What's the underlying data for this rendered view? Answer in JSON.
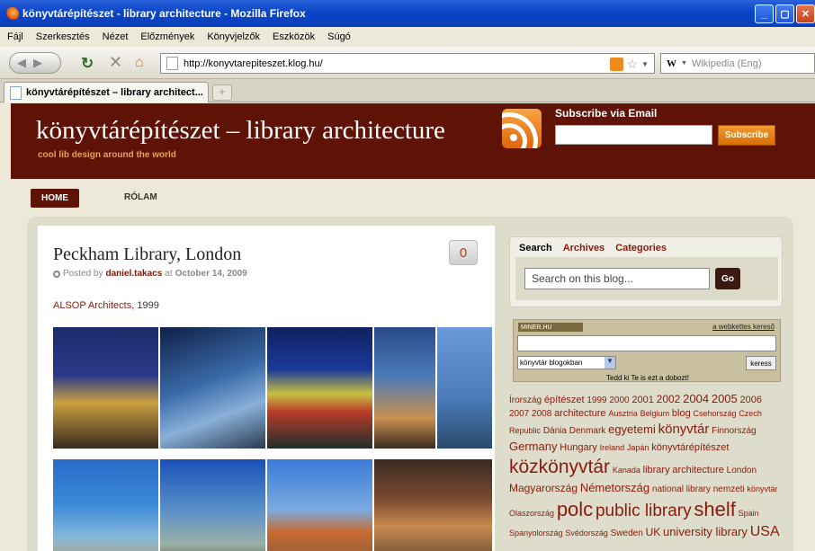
{
  "window": {
    "title": "könyvtárépítészet - library architecture - Mozilla Firefox"
  },
  "menu": [
    "Fájl",
    "Szerkesztés",
    "Nézet",
    "Előzmények",
    "Könyvjelzők",
    "Eszközök",
    "Súgó"
  ],
  "nav": {
    "url": "http://konyvtarepiteszet.klog.hu/",
    "search_engine_letter": "W",
    "search_placeholder": "Wikipedia (Eng)"
  },
  "tab": {
    "label": "könyvtárépítészet – library architect...",
    "new_tab": "+"
  },
  "site": {
    "title": "könyvtárépítészet – library architecture",
    "tagline": "cool lib design around the world",
    "subscribe_label": "Subscribe via Email",
    "subscribe_button": "Subscribe",
    "menu": {
      "home": "HOME",
      "rolam": "RÓLAM"
    }
  },
  "post": {
    "title": "Peckham Library, London",
    "posted_by": "Posted by",
    "author": "daniel.takacs",
    "at": "at",
    "date": "October 14, 2009",
    "comments": "0",
    "text_link": "ALSOP Architects",
    "text_rest": ", 1999"
  },
  "sidebar": {
    "tabs": [
      "Search",
      "Archives",
      "Categories"
    ],
    "search_placeholder": "Search on this blog...",
    "search_button": "Go"
  },
  "miner": {
    "logo": "MINER.HU",
    "link": "a webkettes kereső",
    "select": "könyvtár blogokban",
    "button": "keress",
    "footer": "Tedd ki Te is ezt a dobozt!"
  },
  "tags": [
    {
      "t": "Írország",
      "s": 10
    },
    {
      "t": "építészet",
      "s": 11
    },
    {
      "t": "1999",
      "s": 10
    },
    {
      "t": "2000",
      "s": 10
    },
    {
      "t": "2001",
      "s": 11
    },
    {
      "t": "2002",
      "s": 12
    },
    {
      "t": "2004",
      "s": 13
    },
    {
      "t": "2005",
      "s": 13
    },
    {
      "t": "2006",
      "s": 11
    },
    {
      "t": "2007",
      "s": 10
    },
    {
      "t": "2008",
      "s": 10
    },
    {
      "t": "architecture",
      "s": 11
    },
    {
      "t": "Ausztria",
      "s": 9
    },
    {
      "t": "Belgium",
      "s": 9
    },
    {
      "t": "blog",
      "s": 11
    },
    {
      "t": "Csehország",
      "s": 9
    },
    {
      "t": "Czech Republic",
      "s": 9
    },
    {
      "t": "Dánia",
      "s": 10
    },
    {
      "t": "Denmark",
      "s": 10
    },
    {
      "t": "egyetemi",
      "s": 13
    },
    {
      "t": "könyvtár",
      "s": 15
    },
    {
      "t": "Finnország",
      "s": 10
    },
    {
      "t": "Germany",
      "s": 13
    },
    {
      "t": "Hungary",
      "s": 11
    },
    {
      "t": "Ireland",
      "s": 9
    },
    {
      "t": "Japán",
      "s": 9
    },
    {
      "t": "könyvtárépítészet",
      "s": 11
    },
    {
      "t": "közkönyvtár",
      "s": 21
    },
    {
      "t": "Kanada",
      "s": 9
    },
    {
      "t": "library",
      "s": 11
    },
    {
      "t": "architecture",
      "s": 11
    },
    {
      "t": "London",
      "s": 10
    },
    {
      "t": "Magyarország",
      "s": 12
    },
    {
      "t": "Németország",
      "s": 13
    },
    {
      "t": "national library",
      "s": 10
    },
    {
      "t": "nemzeti",
      "s": 10
    },
    {
      "t": "könyvtár",
      "s": 9
    },
    {
      "t": "Olaszország",
      "s": 9
    },
    {
      "t": "polc",
      "s": 22
    },
    {
      "t": "public library",
      "s": 19
    },
    {
      "t": "shelf",
      "s": 22
    },
    {
      "t": "Spain",
      "s": 9
    },
    {
      "t": "Spanyolország",
      "s": 9
    },
    {
      "t": "Svédország",
      "s": 9
    },
    {
      "t": "Sweden",
      "s": 10
    },
    {
      "t": "UK",
      "s": 12
    },
    {
      "t": "university library",
      "s": 13
    },
    {
      "t": "USA",
      "s": 16
    }
  ]
}
